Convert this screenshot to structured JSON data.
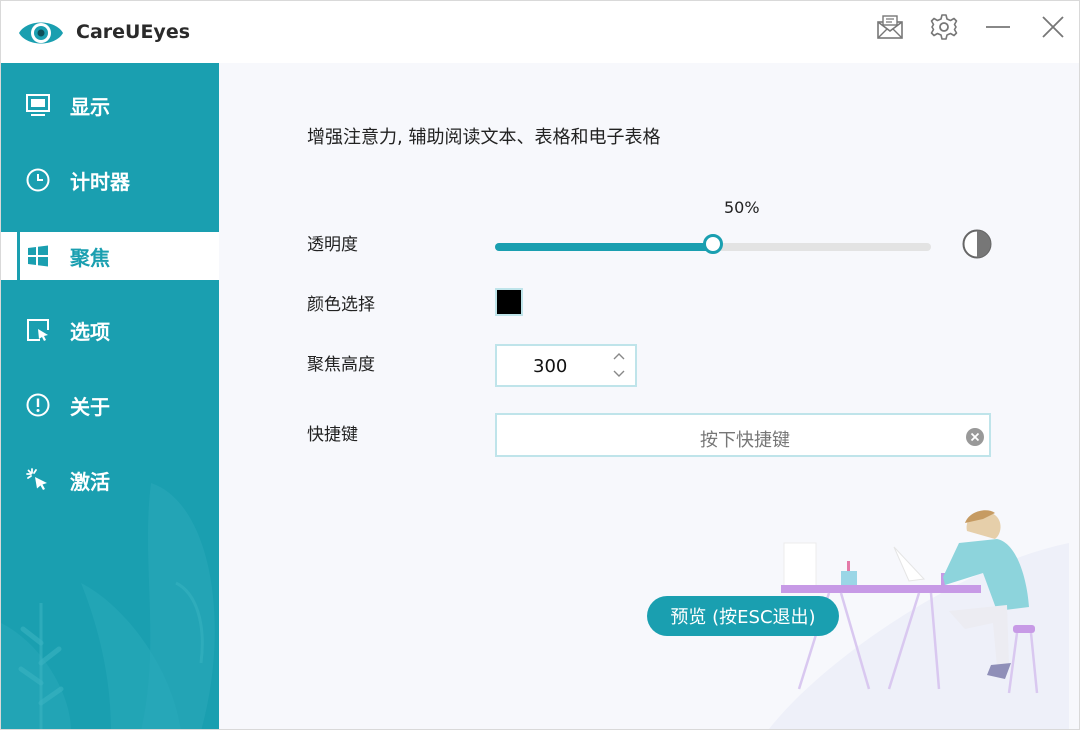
{
  "app": {
    "title": "CareUEyes"
  },
  "titlebar": {
    "icons": [
      "mail-icon",
      "gear-icon",
      "minimize-icon",
      "close-icon"
    ]
  },
  "sidebar": {
    "items": [
      {
        "label": "显示",
        "icon": "monitor-icon",
        "active": false
      },
      {
        "label": "计时器",
        "icon": "clock-icon",
        "active": false
      },
      {
        "label": "聚焦",
        "icon": "windows-icon",
        "active": true
      },
      {
        "label": "选项",
        "icon": "cursor-box-icon",
        "active": false
      },
      {
        "label": "关于",
        "icon": "info-circle-icon",
        "active": false
      },
      {
        "label": "激活",
        "icon": "click-cursor-icon",
        "active": false
      }
    ]
  },
  "main": {
    "description": "增强注意力, 辅助阅读文本、表格和电子表格",
    "transparency": {
      "label": "透明度",
      "value_text": "50%",
      "value": 0.5
    },
    "color": {
      "label": "颜色选择",
      "value": "#000000"
    },
    "focus_height": {
      "label": "聚焦高度",
      "value": "300"
    },
    "hotkey": {
      "label": "快捷键",
      "placeholder": "按下快捷键"
    },
    "preview_button": "预览 (按ESC退出)"
  },
  "colors": {
    "accent": "#1a9fb0",
    "sidebar": "#1a9fb0",
    "background": "#f7f8fc"
  }
}
